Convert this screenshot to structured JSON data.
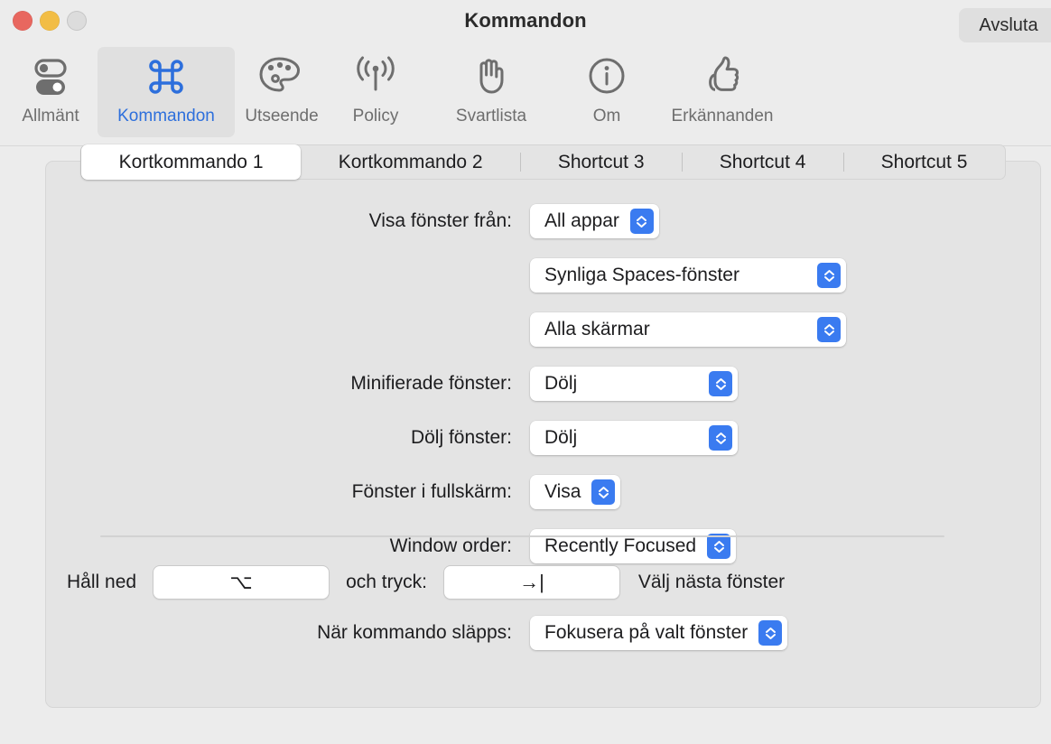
{
  "window": {
    "title": "Kommandon",
    "quit_label": "Avsluta",
    "controls": {
      "close": "close-button",
      "minimize": "minimize-button",
      "zoom": "zoom-button"
    }
  },
  "toolbar": {
    "items": [
      {
        "label": "Allmänt",
        "icon": "toggles-icon",
        "selected": false
      },
      {
        "label": "Kommandon",
        "icon": "command-icon",
        "selected": true
      },
      {
        "label": "Utseende",
        "icon": "palette-icon",
        "selected": false
      },
      {
        "label": "Policy",
        "icon": "broadcast-icon",
        "selected": false
      },
      {
        "label": "Svartlista",
        "icon": "hand-raised-icon",
        "selected": false
      },
      {
        "label": "Om",
        "icon": "info-circle-icon",
        "selected": false
      },
      {
        "label": "Erkännanden",
        "icon": "thumbs-up-icon",
        "selected": false
      }
    ],
    "selected_color": "#2d6fdc",
    "inactive_color": "#6e6e6e"
  },
  "tabs": [
    {
      "label": "Kortkommando 1",
      "active": true
    },
    {
      "label": "Kortkommando 2",
      "active": false
    },
    {
      "label": "Shortcut 3",
      "active": false
    },
    {
      "label": "Shortcut 4",
      "active": false
    },
    {
      "label": "Shortcut 5",
      "active": false
    }
  ],
  "form": {
    "show_windows_from_label": "Visa fönster från:",
    "show_windows_from_value": "All appar",
    "spaces_value": "Synliga Spaces-fönster",
    "screens_value": "Alla skärmar",
    "minimized_label": "Minifierade fönster:",
    "minimized_value": "Dölj",
    "hidden_label": "Dölj fönster:",
    "hidden_value": "Dölj",
    "fullscreen_label": "Fönster i fullskärm:",
    "fullscreen_value": "Visa",
    "window_order_label": "Window order:",
    "window_order_value": "Recently Focused"
  },
  "hotkey": {
    "hold_label": "Håll ned",
    "modifier_key": "⌥",
    "and_press_label": "och tryck:",
    "trigger_key": "→|",
    "action_label": "Välj nästa fönster",
    "on_release_label": "När kommando släpps:",
    "on_release_value": "Fokusera på valt fönster"
  },
  "colors": {
    "window_bg": "#ececec",
    "panel_bg": "#e4e4e4",
    "accent_blue": "#3a7bf0",
    "tab_active_bg": "#ffffff"
  }
}
